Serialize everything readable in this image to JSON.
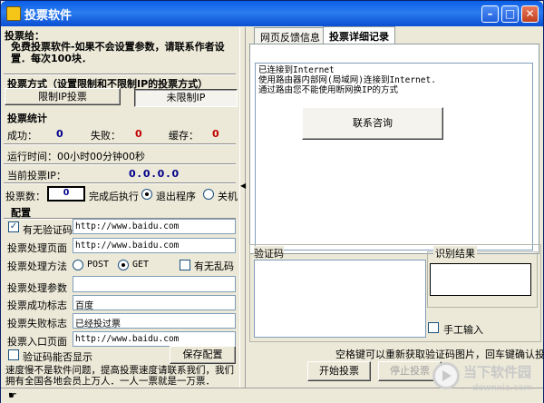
{
  "window": {
    "title": "投票软件"
  },
  "left": {
    "notice_title": "投票给：",
    "notice_text": "免费投票软件-如果不会设置参数，请联系作者设置．每次100块．",
    "method_title": "投票方式（设置限制和不限制IP的投票方式）",
    "limit_ip_button": "限制IP投票",
    "no_limit_button": "未限制IP",
    "stats_title": "投票统计",
    "success_label": "成功：",
    "success_value": "0",
    "fail_label": "失败：",
    "fail_value": "0",
    "cache_label": "缓存：",
    "cache_value": "0",
    "runtime_label": "运行时间：00小时00分钟00秒",
    "ip_label": "当前投票IP：",
    "ip_value": "0.0.0.0",
    "count_label": "投票数：",
    "count_value": "0",
    "after_label": "完成后执行",
    "exit_label": "退出程序",
    "shutdown_label": "关机",
    "config_title": "配置",
    "captcha_check_label": "有无验证码",
    "captcha_url": "http://www.baidu.com",
    "page_label": "投票处理页面",
    "page_url": "http://www.baidu.com",
    "method_label": "投票处理方法",
    "post_label": "POST",
    "get_label": "GET",
    "garble_label": "有无乱码",
    "param_label": "投票处理参数",
    "param_value": "",
    "success_flag_label": "投票成功标志",
    "success_flag_value": "百度",
    "fail_flag_label": "投票失败标志",
    "fail_flag_value": "已经投过票",
    "entry_label": "投票入口页面",
    "entry_url": "http://www.baidu.com",
    "captcha_show_label": "验证码能否显示",
    "save_button": "保存配置",
    "footer_text": "速度慢不是软件问题，提高投票速度请联系我们，我们拥有全国各地会员上万人．一人一票就是一万票．"
  },
  "right": {
    "tab_feedback": "网页反馈信息",
    "tab_records": "投票详细记录",
    "messages": [
      "已连接到Internet",
      "使用路由器内部网(局域网)连接到Internet.",
      "通过路由您不能使用断网换IP的方式"
    ],
    "contact_button": "联系咨询",
    "captcha_title": "验证码",
    "result_title": "识别结果",
    "manual_label": "手工输入",
    "hint_text": "空格键可以重新获取验证码图片，回车键确认投票",
    "start_button": "开始投票",
    "stop_button": "停止投票"
  },
  "watermark": {
    "brand": "当下软件园",
    "url": "downxia.com"
  }
}
